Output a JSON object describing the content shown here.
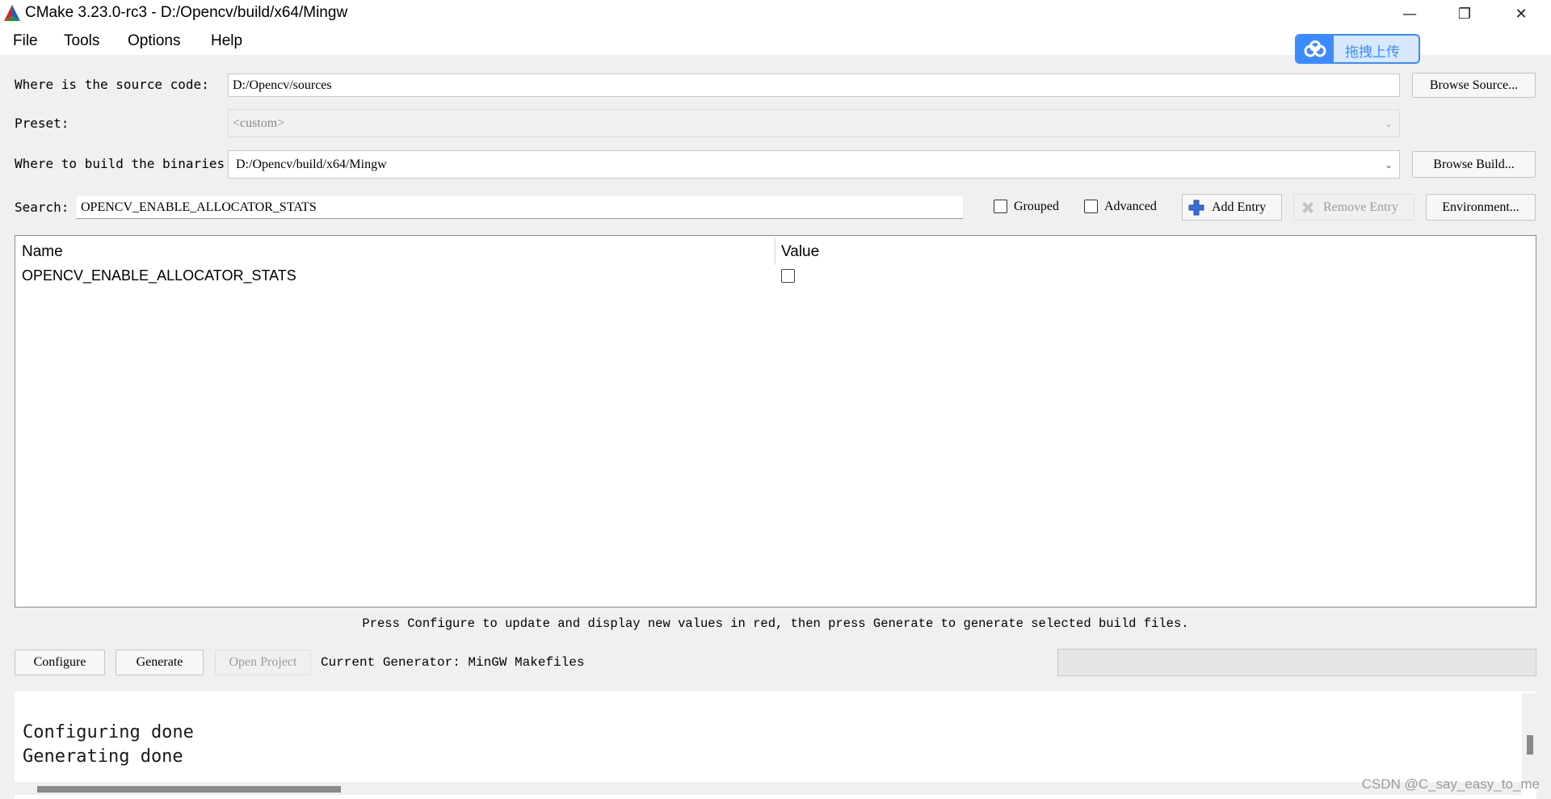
{
  "window": {
    "title": "CMake 3.23.0-rc3 - D:/Opencv/build/x64/Mingw",
    "minimize": "—",
    "restore": "❐",
    "close": "✕"
  },
  "menu": [
    "File",
    "Tools",
    "Options",
    "Help"
  ],
  "upload_widget": {
    "label": "拖拽上传"
  },
  "source": {
    "label": "Where is the source code:",
    "value": "D:/Opencv/sources",
    "browse_label": "Browse Source..."
  },
  "preset": {
    "label": "Preset:",
    "value": "<custom>"
  },
  "build": {
    "label": "Where to build the binaries:",
    "value": "D:/Opencv/build/x64/Mingw",
    "browse_label": "Browse Build..."
  },
  "search": {
    "label": "Search:",
    "value": "OPENCV_ENABLE_ALLOCATOR_STATS"
  },
  "options": {
    "grouped_label": "Grouped",
    "advanced_label": "Advanced",
    "add_entry_label": "Add Entry",
    "remove_entry_label": "Remove Entry",
    "environment_label": "Environment..."
  },
  "table": {
    "columns": [
      "Name",
      "Value"
    ],
    "rows": [
      {
        "name": "OPENCV_ENABLE_ALLOCATOR_STATS",
        "checked": false
      }
    ]
  },
  "hint": "Press Configure to update and display new values in red, then press Generate to generate selected build files.",
  "actions": {
    "configure_label": "Configure",
    "generate_label": "Generate",
    "open_project_label": "Open Project",
    "generator_text": "Current Generator: MinGW Makefiles"
  },
  "output_log": [
    "Configuring done",
    "Generating done"
  ],
  "watermark": "CSDN @C_say_easy_to_me",
  "colors": {
    "accent_blue": "#3b8bff",
    "window_bg": "#f0f0f0",
    "field_bg": "#ffffff",
    "icon_red": "#d9261c",
    "icon_green": "#2e8b3a",
    "icon_blue": "#1f5fbf"
  }
}
